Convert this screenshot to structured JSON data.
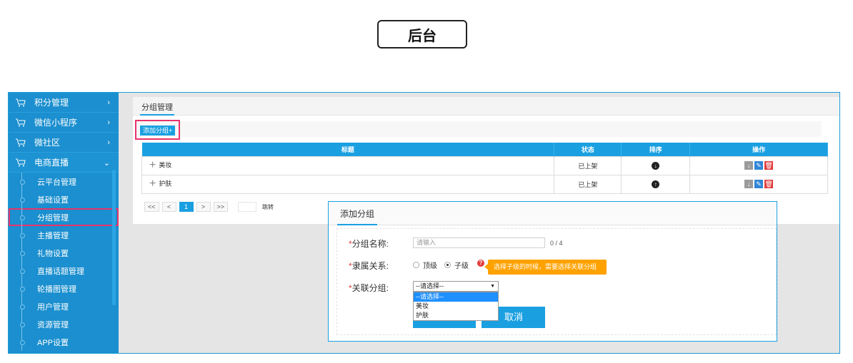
{
  "page_title": "后台",
  "sidebar": {
    "menus": [
      {
        "label": "积分管理",
        "chevron": "›"
      },
      {
        "label": "微信小程序",
        "chevron": "›"
      },
      {
        "label": "微社区",
        "chevron": "›"
      },
      {
        "label": "电商直播",
        "chevron": "⌄"
      }
    ],
    "subitems": [
      {
        "label": "云平台管理"
      },
      {
        "label": "基础设置"
      },
      {
        "label": "分组管理"
      },
      {
        "label": "主播管理"
      },
      {
        "label": "礼物设置"
      },
      {
        "label": "直播话题管理"
      },
      {
        "label": "轮播图管理"
      },
      {
        "label": "用户管理"
      },
      {
        "label": "资源管理"
      },
      {
        "label": "APP设置"
      }
    ]
  },
  "panel": {
    "tab": "分组管理",
    "add_button": "添加分组+",
    "columns": [
      "标题",
      "状态",
      "排序",
      "操作"
    ],
    "rows": [
      {
        "title": "美妆",
        "status": "已上架",
        "sort_icon": "arrow-down"
      },
      {
        "title": "护肤",
        "status": "已上架",
        "sort_icon": "arrow-up"
      }
    ],
    "pager": {
      "first": "<<",
      "prev": "<",
      "current": "1",
      "next": ">",
      "last": ">>",
      "jump": "跳转"
    }
  },
  "modal": {
    "tab": "添加分组",
    "name_label": "分组名称:",
    "name_placeholder": "请输入",
    "name_count": "0 / 4",
    "relation_label": "隶属关系:",
    "radio_top": "顶级",
    "radio_child": "子级",
    "tip": "选择子级的时候，需要选择关联分组",
    "link_label": "关联分组:",
    "select_value": "--请选择--",
    "options": [
      "--请选择--",
      "美妆",
      "护肤"
    ],
    "cancel": "取消"
  },
  "colors": {
    "accent": "#1aa0e1",
    "sidebar": "#1b8fcf",
    "highlight": "#e8356b",
    "tip": "#ffa200"
  }
}
